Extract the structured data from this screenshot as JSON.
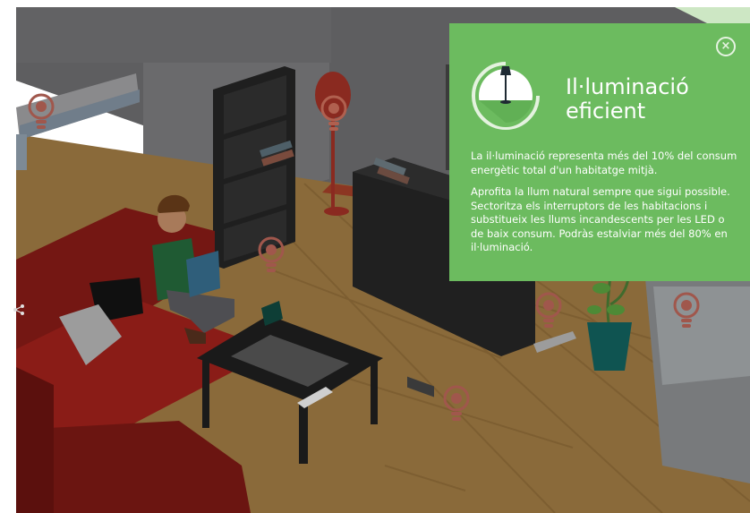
{
  "info_panel": {
    "title_line1": "Il·luminació",
    "title_line2": "eficient",
    "paragraph1": "La il·luminació representa més del 10% del consum energètic total d'un habitatge mitjà.",
    "paragraph2": "Aprofita la llum natural sempre que sigui possible. Sectoritza els interruptors de les habitacions i substitueix les llums incandescents per les LED o de baix consum. Podràs estalviar més del 80% en il·luminació.",
    "close_icon": "close-icon",
    "emblem_icon": "floor-lamp-icon",
    "background_color": "#6cbb5f"
  },
  "hotspots": [
    {
      "name": "hotspot-air-conditioner",
      "icon": "lightbulb-icon"
    },
    {
      "name": "hotspot-floor-lamp",
      "icon": "lightbulb-icon"
    },
    {
      "name": "hotspot-shelf",
      "icon": "lightbulb-icon"
    },
    {
      "name": "hotspot-floor",
      "icon": "lightbulb-icon"
    },
    {
      "name": "hotspot-tv-unit",
      "icon": "lightbulb-icon"
    },
    {
      "name": "hotspot-window",
      "icon": "lightbulb-icon"
    }
  ],
  "share_icon": "share-icon"
}
